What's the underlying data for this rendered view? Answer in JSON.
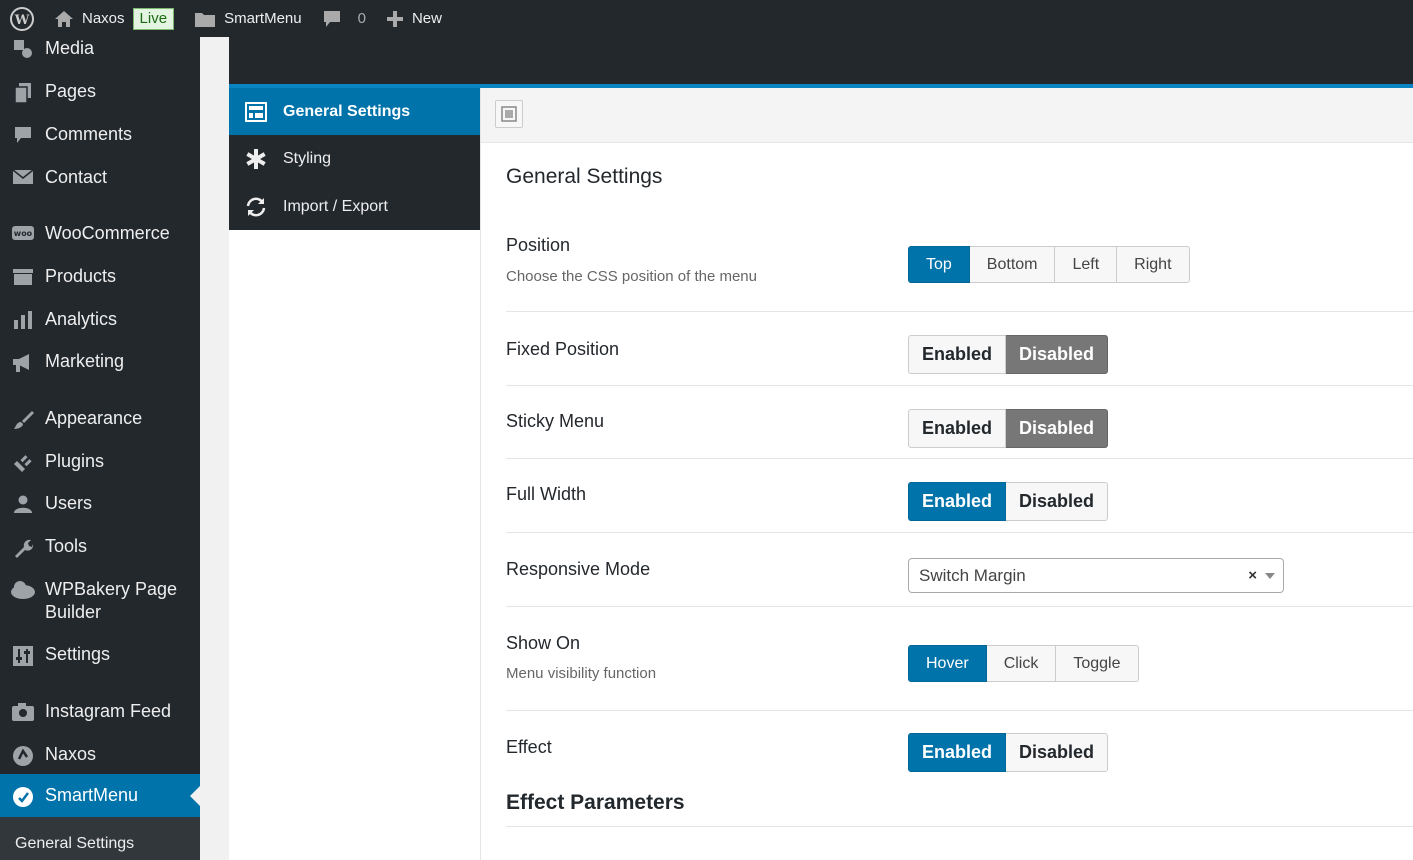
{
  "adminbar": {
    "site_name": "Naxos",
    "live_badge": "Live",
    "plugin_name": "SmartMenu",
    "comments_count": "0",
    "new_label": "New"
  },
  "sidebar": {
    "items": [
      {
        "label": "Media",
        "icon": "media-icon"
      },
      {
        "label": "Pages",
        "icon": "pages-icon"
      },
      {
        "label": "Comments",
        "icon": "comment-icon"
      },
      {
        "label": "Contact",
        "icon": "mail-icon"
      },
      {
        "label": "WooCommerce",
        "icon": "woo-icon"
      },
      {
        "label": "Products",
        "icon": "archive-icon"
      },
      {
        "label": "Analytics",
        "icon": "bar-chart-icon"
      },
      {
        "label": "Marketing",
        "icon": "megaphone-icon"
      },
      {
        "label": "Appearance",
        "icon": "brush-icon"
      },
      {
        "label": "Plugins",
        "icon": "plug-icon"
      },
      {
        "label": "Users",
        "icon": "user-icon"
      },
      {
        "label": "Tools",
        "icon": "wrench-icon"
      },
      {
        "label": "WPBakery Page",
        "label2": "Builder",
        "icon": "cloud-icon"
      },
      {
        "label": "Settings",
        "icon": "sliders-icon"
      },
      {
        "label": "Instagram Feed",
        "icon": "camera-icon"
      },
      {
        "label": "Naxos",
        "icon": "naxos-icon"
      },
      {
        "label": "SmartMenu",
        "icon": "smartmenu-icon"
      }
    ],
    "submenu_current": "General Settings"
  },
  "tabs": [
    {
      "label": "General Settings",
      "icon": "layout-icon"
    },
    {
      "label": "Styling",
      "icon": "asterisk-icon"
    },
    {
      "label": "Import / Export",
      "icon": "refresh-icon"
    }
  ],
  "main": {
    "section_title": "General Settings",
    "rows": {
      "position": {
        "label": "Position",
        "desc": "Choose the CSS position of the menu",
        "options": [
          "Top",
          "Bottom",
          "Left",
          "Right"
        ],
        "selected": "Top"
      },
      "fixed_position": {
        "label": "Fixed Position",
        "options": [
          "Enabled",
          "Disabled"
        ],
        "selected": "Disabled"
      },
      "sticky_menu": {
        "label": "Sticky Menu",
        "options": [
          "Enabled",
          "Disabled"
        ],
        "selected": "Disabled"
      },
      "full_width": {
        "label": "Full Width",
        "options": [
          "Enabled",
          "Disabled"
        ],
        "selected": "Enabled"
      },
      "responsive_mode": {
        "label": "Responsive Mode",
        "value": "Switch Margin",
        "clear": "×"
      },
      "show_on": {
        "label": "Show On",
        "desc": "Menu visibility function",
        "options": [
          "Hover",
          "Click",
          "Toggle"
        ],
        "selected": "Hover"
      },
      "effect": {
        "label": "Effect",
        "options": [
          "Enabled",
          "Disabled"
        ],
        "selected": "Enabled"
      }
    },
    "subsection_title": "Effect Parameters"
  },
  "colors": {
    "accent": "#0073aa",
    "admin_dark": "#23282d",
    "disabled_active": "#777777"
  }
}
